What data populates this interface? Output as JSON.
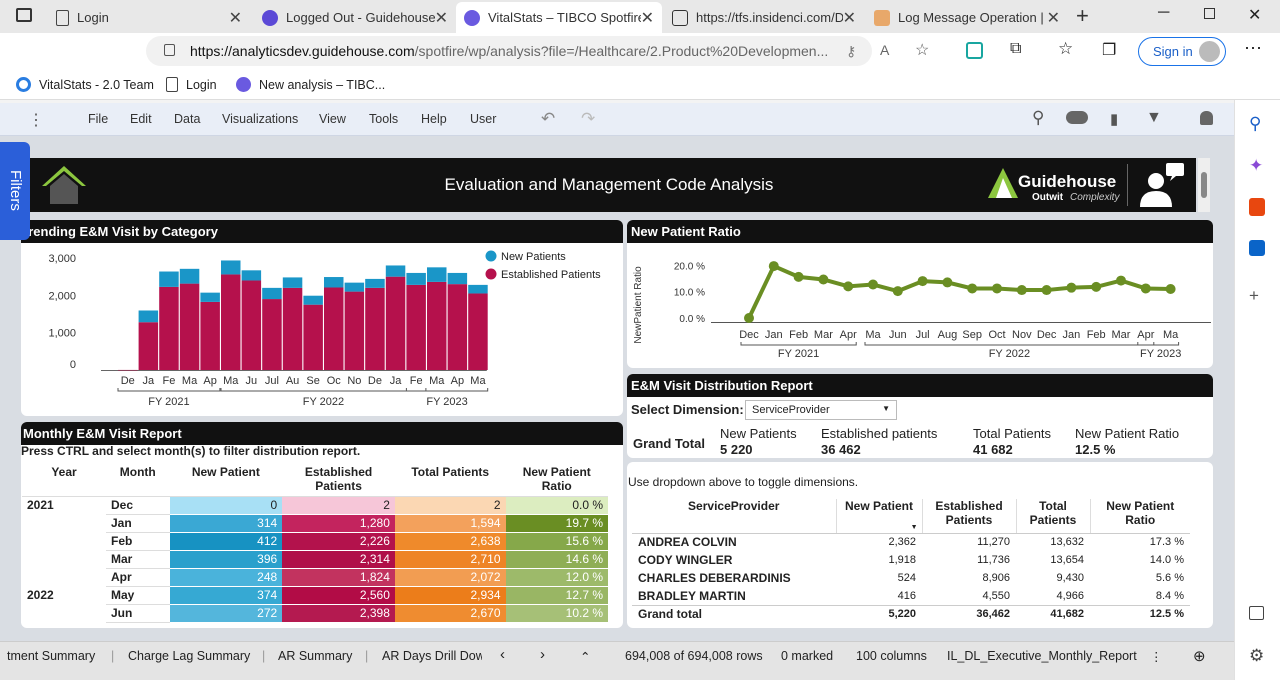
{
  "browser": {
    "tabs": [
      {
        "label": "Login",
        "active": false
      },
      {
        "label": "Logged Out - Guidehouse",
        "active": false
      },
      {
        "label": "VitalStats – TIBCO Spotfire",
        "active": true
      },
      {
        "label": "https://tfs.insidenci.com/D",
        "active": false
      },
      {
        "label": "Log Message Operation |",
        "active": false
      }
    ],
    "url_host": "https://analyticsdev.guidehouse.com",
    "url_rest": "/spotfire/wp/analysis?file=/Healthcare/2.Product%20Developmen...",
    "sign_in": "Sign in",
    "bookmarks": [
      "VitalStats - 2.0 Team",
      "Login",
      "New analysis – TIBC..."
    ]
  },
  "menu": [
    "File",
    "Edit",
    "Data",
    "Visualizations",
    "View",
    "Tools",
    "Help",
    "User"
  ],
  "filters_label": "Filters",
  "banner": {
    "title": "Evaluation and Management Code Analysis",
    "logo_name": "Guidehouse",
    "logo_tag1": "Outwit",
    "logo_tag2": "Complexity"
  },
  "trend": {
    "title": "Trending E&M Visit by Category"
  },
  "ratio": {
    "title": "New Patient Ratio",
    "ylabel": "NewPatient Ratio"
  },
  "chart_data": [
    {
      "type": "bar",
      "title": "Trending E&M Visit by Category",
      "categories": [
        "De",
        "Ja",
        "Fe",
        "Ma",
        "Ap",
        "Ma",
        "Ju",
        "Jul",
        "Au",
        "Se",
        "Oc",
        "No",
        "De",
        "Ja",
        "Fe",
        "Ma",
        "Ap",
        "Ma"
      ],
      "groups": [
        {
          "label": "FY 2021"
        },
        {
          "label": "FY 2022"
        },
        {
          "label": "FY 2023"
        }
      ],
      "series": [
        {
          "name": "Established Patients",
          "color": "#b5114c",
          "values": [
            2,
            1280,
            2226,
            2314,
            1824,
            2560,
            2398,
            1900,
            2200,
            1750,
            2210,
            2100,
            2200,
            2500,
            2280,
            2360,
            2300,
            2050
          ]
        },
        {
          "name": "New Patients",
          "color": "#1a96c8",
          "values": [
            0,
            314,
            412,
            396,
            248,
            374,
            272,
            300,
            280,
            240,
            280,
            240,
            240,
            300,
            320,
            390,
            300,
            230
          ]
        }
      ],
      "ylim": [
        0,
        3000
      ],
      "yticks": [
        "0",
        "1,000",
        "2,000",
        "3,000"
      ],
      "legend": "top-right"
    },
    {
      "type": "line",
      "title": "New Patient Ratio",
      "x": [
        "Dec",
        "Jan",
        "Feb",
        "Mar",
        "Apr",
        "Ma",
        "Jun",
        "Jul",
        "Aug",
        "Sep",
        "Oct",
        "Nov",
        "Dec",
        "Jan",
        "Feb",
        "Mar",
        "Apr",
        "Ma"
      ],
      "groups": [
        {
          "label": "FY 2021"
        },
        {
          "label": "FY 2022"
        },
        {
          "label": "FY 2023"
        }
      ],
      "values": [
        0.0,
        19.7,
        15.6,
        14.6,
        12.0,
        12.7,
        10.2,
        14.0,
        13.5,
        11.2,
        11.2,
        10.6,
        10.6,
        11.5,
        11.8,
        14.2,
        11.2,
        11.0
      ],
      "ylim": [
        0,
        22
      ],
      "yticks": [
        "0.0 %",
        "10.0 %",
        "20.0 %"
      ],
      "ylabel": "NewPatient Ratio",
      "color": "#6a8e23"
    }
  ],
  "monthly": {
    "title": "Monthly E&M Visit Report",
    "subtitle": "Press CTRL and select month(s) to filter distribution report.",
    "headers": [
      "Year",
      "Month",
      "New Patient",
      "Established Patients",
      "Total Patients",
      "New Patient Ratio"
    ],
    "rows": [
      {
        "year": "2021",
        "month": "Dec",
        "np": "0",
        "ep": "2",
        "tp": "2",
        "npr": "0.0 %"
      },
      {
        "year": "",
        "month": "Jan",
        "np": "314",
        "ep": "1,280",
        "tp": "1,594",
        "npr": "19.7 %"
      },
      {
        "year": "",
        "month": "Feb",
        "np": "412",
        "ep": "2,226",
        "tp": "2,638",
        "npr": "15.6 %"
      },
      {
        "year": "",
        "month": "Mar",
        "np": "396",
        "ep": "2,314",
        "tp": "2,710",
        "npr": "14.6 %"
      },
      {
        "year": "",
        "month": "Apr",
        "np": "248",
        "ep": "1,824",
        "tp": "2,072",
        "npr": "12.0 %"
      },
      {
        "year": "2022",
        "month": "May",
        "np": "374",
        "ep": "2,560",
        "tp": "2,934",
        "npr": "12.7 %"
      },
      {
        "year": "",
        "month": "Jun",
        "np": "272",
        "ep": "2,398",
        "tp": "2,670",
        "npr": "10.2 %"
      }
    ]
  },
  "dist": {
    "title": "E&M Visit Distribution Report",
    "select_label": "Select Dimension:",
    "select_value": "ServiceProvider",
    "grand_label": "Grand Total",
    "kpis": [
      {
        "label": "New Patients",
        "value": "5 220"
      },
      {
        "label": "Established patients",
        "value": "36 462"
      },
      {
        "label": "Total Patients",
        "value": "41 682"
      },
      {
        "label": "New Patient Ratio",
        "value": "12.5 %"
      }
    ],
    "hint": "Use dropdown above to toggle dimensions.",
    "headers": [
      "ServiceProvider",
      "New Patient",
      "Established Patients",
      "Total Patients",
      "New Patient Ratio"
    ],
    "rows": [
      {
        "name": "ANDREA COLVIN",
        "np": "2,362",
        "ep": "11,270",
        "tp": "13,632",
        "npr": "17.3 %"
      },
      {
        "name": "CODY WINGLER",
        "np": "1,918",
        "ep": "11,736",
        "tp": "13,654",
        "npr": "14.0 %"
      },
      {
        "name": "CHARLES DEBERARDINIS",
        "np": "524",
        "ep": "8,906",
        "tp": "9,430",
        "npr": "5.6 %"
      },
      {
        "name": "BRADLEY MARTIN",
        "np": "416",
        "ep": "4,550",
        "tp": "4,966",
        "npr": "8.4 %"
      }
    ],
    "total": {
      "name": "Grand total",
      "np": "5,220",
      "ep": "36,462",
      "tp": "41,682",
      "npr": "12.5 %"
    }
  },
  "status": {
    "tabs": [
      "tment Summary",
      "Charge Lag Summary",
      "AR Summary",
      "AR Days Drill Dow"
    ],
    "rows": "694,008 of 694,008 rows",
    "marked": "0 marked",
    "columns": "100 columns",
    "table": "IL_DL_Executive_Monthly_Report"
  }
}
